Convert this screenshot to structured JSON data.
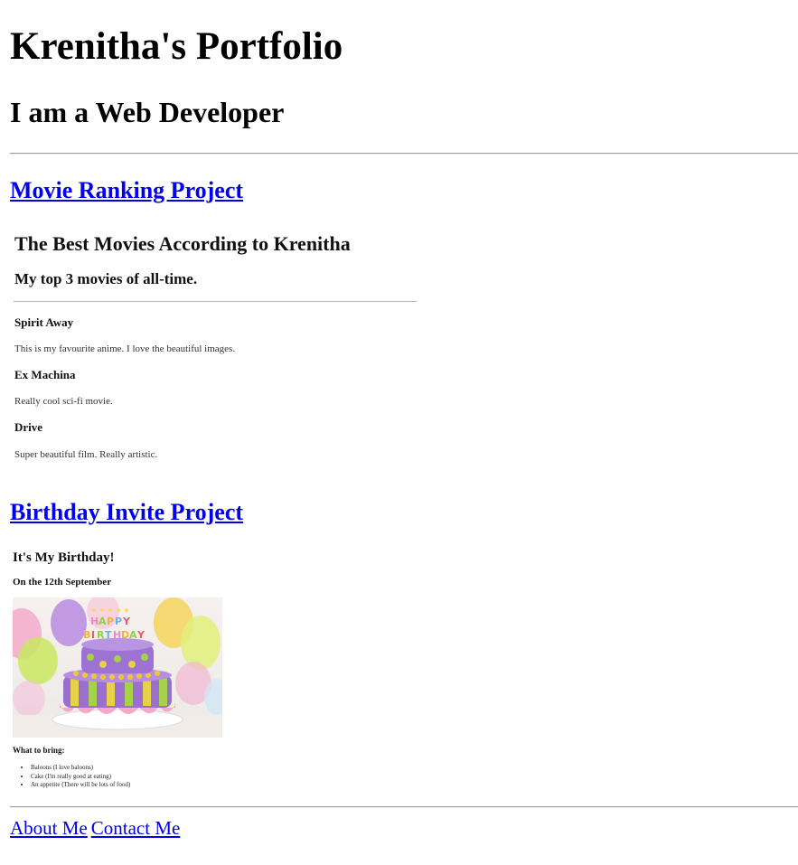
{
  "header": {
    "title": "Krenitha's Portfolio",
    "subtitle": "I am a Web Developer"
  },
  "projects": [
    {
      "link_label": "Movie Ranking Project",
      "preview": {
        "title": "The Best Movies According to Krenitha",
        "subtitle": "My top 3 movies of all-time.",
        "movies": [
          {
            "title": "Spirit Away",
            "description": "This is my favourite anime. I love the beautiful images."
          },
          {
            "title": "Ex Machina",
            "description": "Really cool sci-fi movie."
          },
          {
            "title": "Drive",
            "description": "Super beautiful film. Really artistic."
          }
        ]
      }
    },
    {
      "link_label": "Birthday Invite Project",
      "preview": {
        "title": "It's My Birthday!",
        "date": "On the 12th September",
        "image": "birthday-cake-image",
        "bring_heading": "What to bring:",
        "bring_items": [
          "Baloons (I love baloons)",
          "Cake (I'm really good at eating)",
          "An appetite (There will be lots of food)"
        ]
      }
    }
  ],
  "footer": {
    "about_label": "About Me",
    "contact_label": "Contact Me"
  }
}
